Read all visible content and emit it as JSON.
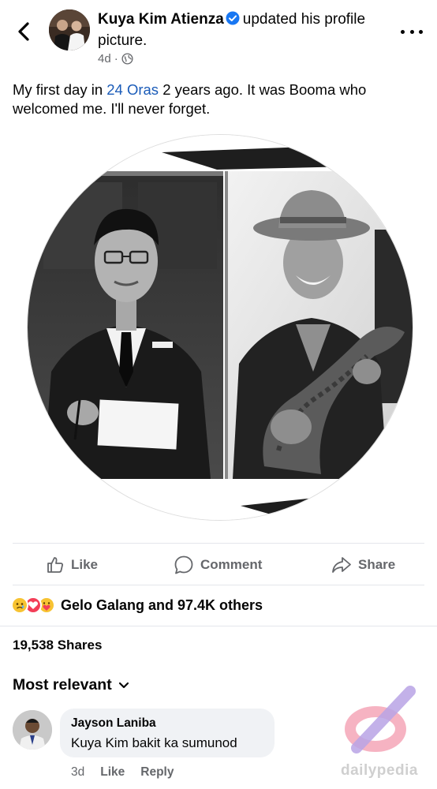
{
  "post": {
    "author": "Kuya Kim Atienza",
    "action_text": "updated his profile picture.",
    "time": "4d",
    "caption_before": "My first day in ",
    "caption_link": "24 Oras",
    "caption_after": " 2 years ago. It was Booma who welcomed me. I'll never forget."
  },
  "actions": {
    "like": "Like",
    "comment": "Comment",
    "share": "Share"
  },
  "reactions": {
    "summary": "Gelo Galang and 97.4K others"
  },
  "shares": "19,538 Shares",
  "comments": {
    "sort_label": "Most relevant",
    "items": [
      {
        "author": "Jayson Laniba",
        "text": "Kuya Kim bakit ka sumunod",
        "time": "3d",
        "like": "Like",
        "reply": "Reply"
      }
    ]
  },
  "watermark": "dailypedia",
  "colors": {
    "link": "#1a5bb8",
    "verified": "#1877f2",
    "secondary_text": "#65676b",
    "divider": "#e4e6eb"
  },
  "icons": {
    "back": "chevron-left-icon",
    "verified": "verified-badge-icon",
    "audience": "globe-icon",
    "more": "more-dots-icon",
    "like": "thumbs-up-icon",
    "comment": "comment-bubble-icon",
    "share": "share-arrow-icon",
    "sort": "chevron-down-icon"
  }
}
